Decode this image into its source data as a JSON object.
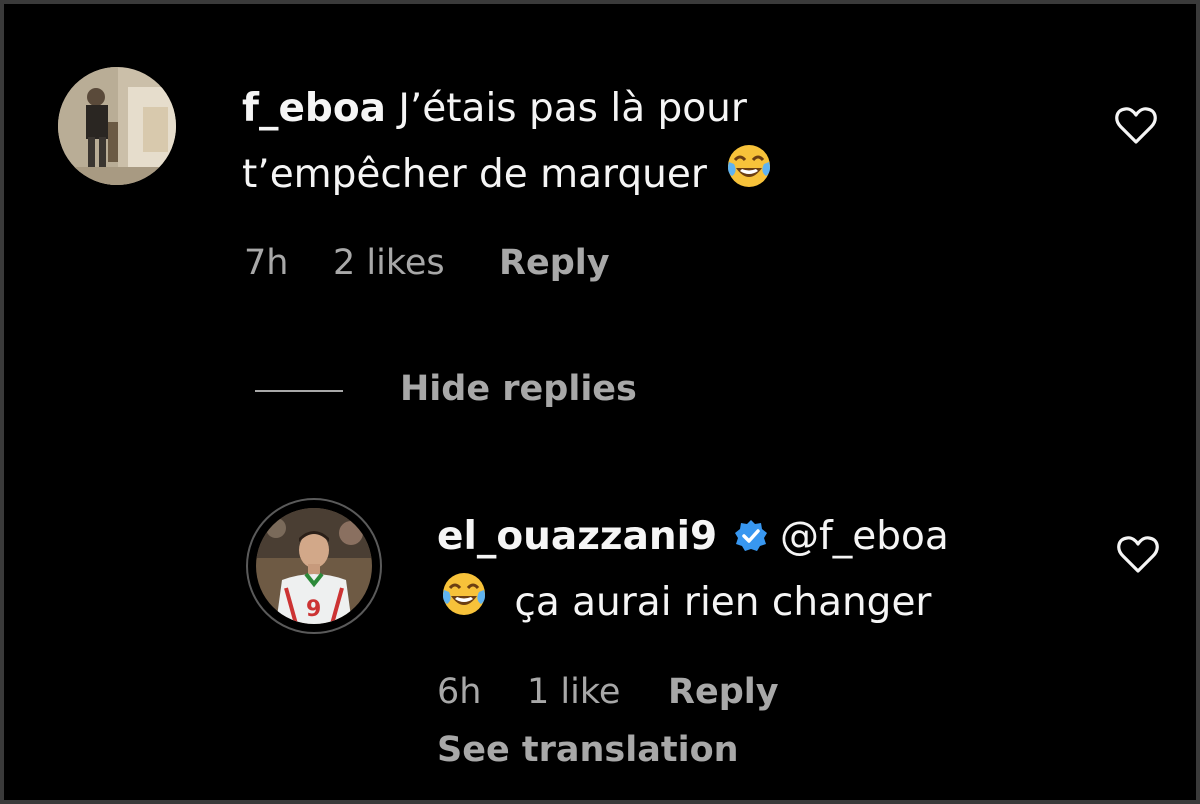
{
  "comment": {
    "username": "f_eboa",
    "text_line1": "J’étais pas là pour",
    "text_line2": "t’empêcher de marquer",
    "emoji": "face-with-tears-of-joy-emoji",
    "time": "7h",
    "likes": "2 likes",
    "reply_label": "Reply",
    "avatar_icon": "user-avatar-photo",
    "like_icon": "heart-outline-icon"
  },
  "hide_replies_label": "Hide replies",
  "reply": {
    "username": "el_ouazzani9",
    "verified_icon": "verified-badge-icon",
    "mention": "@f_eboa",
    "emoji": "face-with-tears-of-joy-emoji",
    "text": "ça aurai rien changer",
    "time": "6h",
    "likes": "1 like",
    "reply_label": "Reply",
    "see_translation_label": "See translation",
    "avatar_icon": "user-avatar-photo",
    "like_icon": "heart-outline-icon"
  },
  "colors": {
    "background": "#000000",
    "text": "#f5f5f5",
    "secondary_text": "#a8a8a8",
    "verified_badge": "#3897f0"
  }
}
